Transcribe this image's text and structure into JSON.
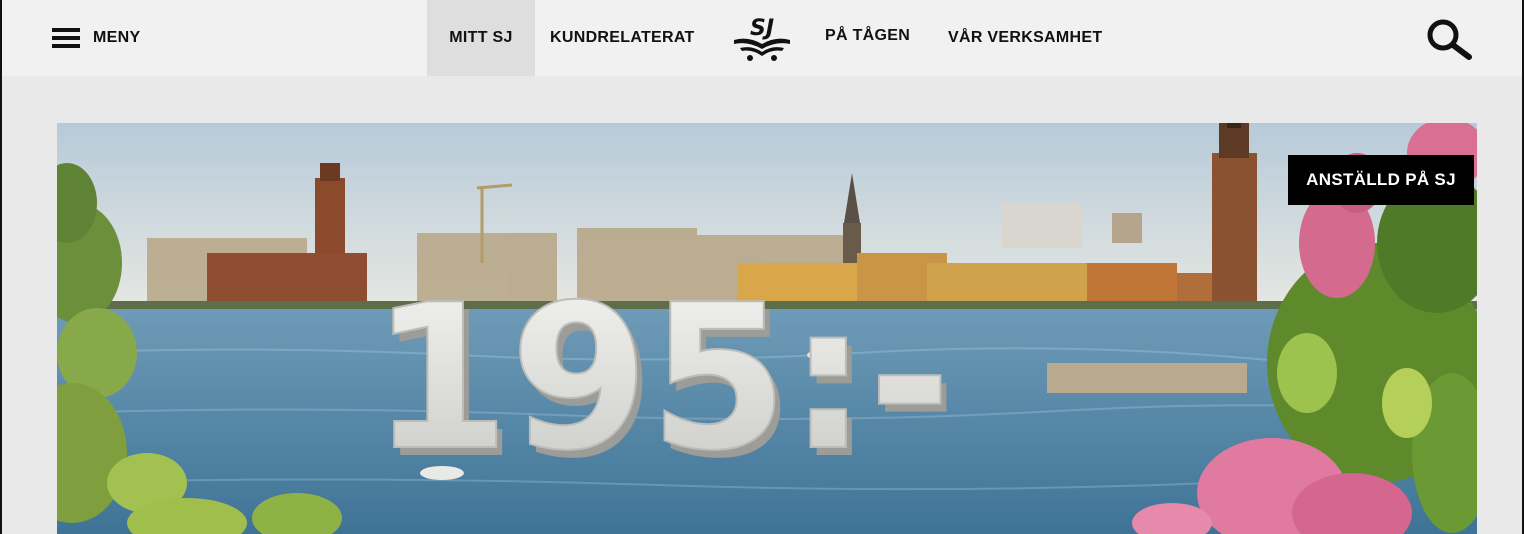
{
  "header": {
    "menu_label": "MENY",
    "nav": [
      {
        "label": "MITT SJ",
        "active": true
      },
      {
        "label": "KUNDRELATERAT"
      },
      {
        "label": "PÅ TÅGEN"
      },
      {
        "label": "VÅR VERKSAMHET"
      }
    ],
    "logo_text": "SJ",
    "icons": {
      "menu": "hamburger-icon",
      "search": "search-icon"
    }
  },
  "hero": {
    "price": "195:-",
    "badge": "ANSTÄLLD PÅ SJ"
  },
  "colors": {
    "header_bg": "#f1f1f1",
    "active_tab_bg": "#dedede",
    "page_bg": "#e9e9e9",
    "badge_bg": "#000000",
    "badge_text": "#ffffff"
  }
}
